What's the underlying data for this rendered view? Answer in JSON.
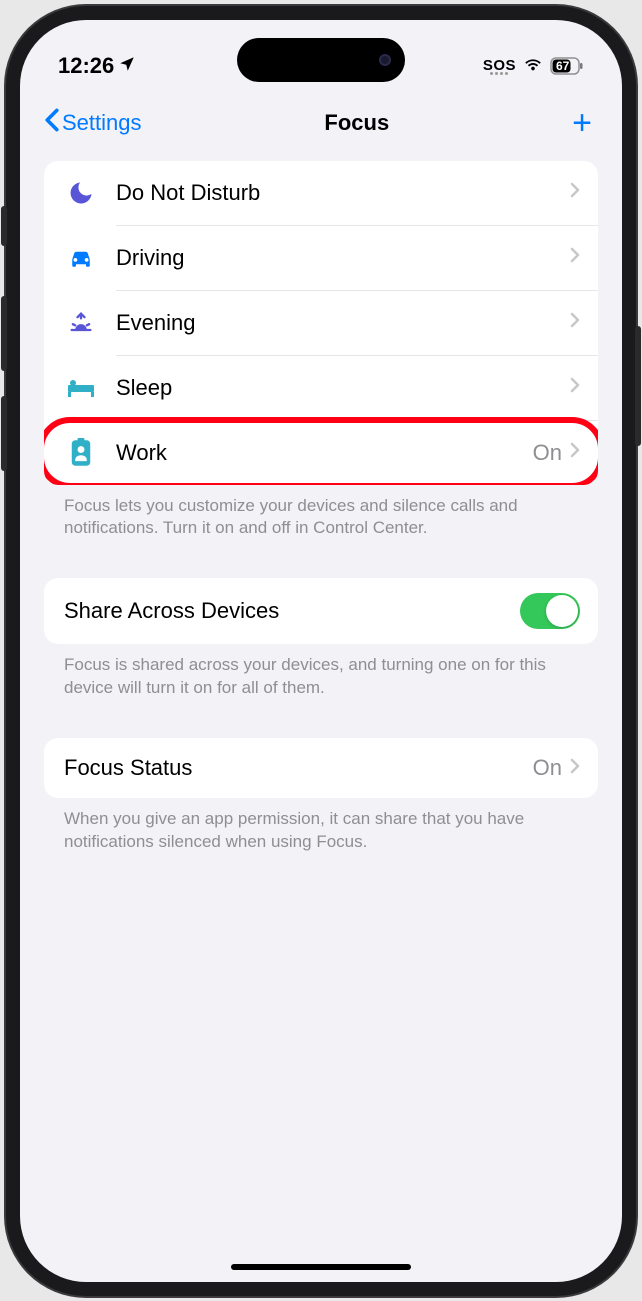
{
  "status": {
    "time": "12:26",
    "sos": "SOS",
    "battery": "67"
  },
  "nav": {
    "back": "Settings",
    "title": "Focus"
  },
  "modes": [
    {
      "label": "Do Not Disturb",
      "status": ""
    },
    {
      "label": "Driving",
      "status": ""
    },
    {
      "label": "Evening",
      "status": ""
    },
    {
      "label": "Sleep",
      "status": ""
    },
    {
      "label": "Work",
      "status": "On"
    }
  ],
  "modesFooter": "Focus lets you customize your devices and silence calls and notifications. Turn it on and off in Control Center.",
  "share": {
    "label": "Share Across Devices",
    "footer": "Focus is shared across your devices, and turning one on for this device will turn it on for all of them."
  },
  "focusStatus": {
    "label": "Focus Status",
    "value": "On",
    "footer": "When you give an app permission, it can share that you have notifications silenced when using Focus."
  },
  "colors": {
    "accent": "#007aff",
    "toggleOn": "#34c759",
    "highlight": "#ff0015",
    "iconPurple": "#5856d6",
    "iconBlue": "#007aff",
    "iconTeal": "#30b0c7"
  }
}
